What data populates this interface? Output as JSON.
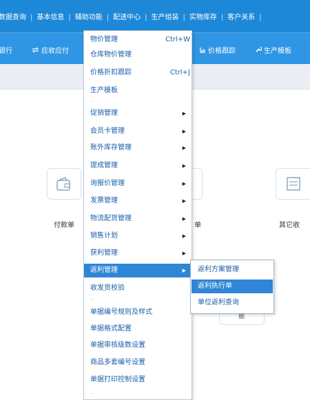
{
  "top_menu": {
    "items": [
      "数据查询",
      "基本信息",
      "辅助功能",
      "配送中心",
      "生产组装",
      "实物库存",
      "客户关系"
    ],
    "separator": "|"
  },
  "toolbar": {
    "item_bank": "银行",
    "item_receivable": "应收应付",
    "item_receivable_icon": "transfer-arrows-icon",
    "item_price_track": "价格跟踪",
    "item_price_track_icon": "chart-icon",
    "item_production_template": "生产模板",
    "item_production_template_icon": "wrench-icon"
  },
  "tiles": {
    "payment_label": "付款单",
    "receipt_label": "单",
    "other_label": "其它收",
    "partial_label": "据"
  },
  "dropdown": {
    "items": [
      {
        "label": "物价管理",
        "shortcut": "Ctrl+W"
      },
      {
        "label": "仓库物价管理"
      },
      {
        "label": "价格折扣跟踪",
        "shortcut": "Ctrl+J"
      },
      {
        "label": "生产模板"
      },
      {
        "label": "促销管理",
        "submenu": true
      },
      {
        "label": "会员卡管理",
        "submenu": true
      },
      {
        "label": "账外库存管理",
        "submenu": true
      },
      {
        "label": "提成管理",
        "submenu": true
      },
      {
        "label": "询报价管理",
        "submenu": true
      },
      {
        "label": "发票管理",
        "submenu": true
      },
      {
        "label": "物流配货管理",
        "submenu": true
      },
      {
        "label": "销售计划",
        "submenu": true
      },
      {
        "label": "获利管理",
        "submenu": true
      },
      {
        "label": "返利管理",
        "submenu": true
      },
      {
        "label": "收发货校验"
      },
      {
        "label": "单据编号规则及样式"
      },
      {
        "label": "单据格式配置"
      },
      {
        "label": "单据审核级数设置"
      },
      {
        "label": "商品多套编号设置"
      },
      {
        "label": "单据打印控制设置"
      }
    ],
    "separator_mark": "-",
    "submenu_arrow": "▶"
  },
  "submenu": {
    "items": [
      "返利方案管理",
      "返利执行单",
      "单位返利查询"
    ]
  },
  "colors": {
    "topbar": "#1e88d8",
    "toolbar": "#2e96e4",
    "highlight": "#2f86d6",
    "menu_text": "#1a5fa8"
  }
}
